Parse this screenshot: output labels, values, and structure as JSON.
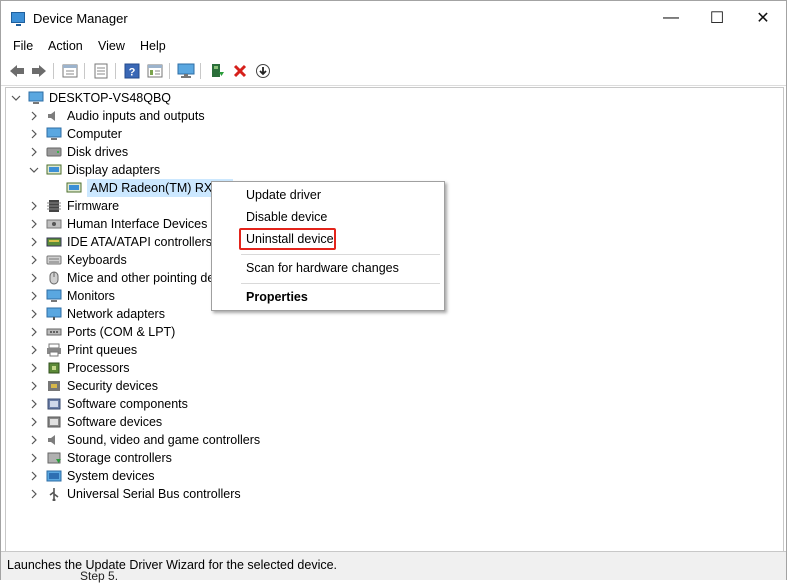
{
  "window": {
    "title": "Device Manager",
    "minimize": "—",
    "maximize": "☐",
    "close": "✕"
  },
  "menu": [
    "File",
    "Action",
    "View",
    "Help"
  ],
  "toolbar": [
    "back-arrow-icon",
    "forward-arrow-icon",
    "properties-icon",
    "list-icon",
    "help-icon",
    "details-icon",
    "monitor-icon",
    "update-driver-icon",
    "remove-icon",
    "download-icon"
  ],
  "tree": {
    "root": "DESKTOP-VS48QBQ",
    "categories": [
      {
        "label": "Audio inputs and outputs",
        "icon": "speaker-icon"
      },
      {
        "label": "Computer",
        "icon": "computer-icon"
      },
      {
        "label": "Disk drives",
        "icon": "disk-icon"
      },
      {
        "label": "Display adapters",
        "icon": "display-adapter-icon"
      },
      {
        "label": "AMD Radeon(TM) RX Ve",
        "icon": "display-adapter-icon"
      },
      {
        "label": "Firmware",
        "icon": "firmware-icon"
      },
      {
        "label": "Human Interface Devices",
        "icon": "hid-icon"
      },
      {
        "label": "IDE ATA/ATAPI controllers",
        "icon": "ide-icon"
      },
      {
        "label": "Keyboards",
        "icon": "keyboard-icon"
      },
      {
        "label": "Mice and other pointing de",
        "icon": "mouse-icon"
      },
      {
        "label": "Monitors",
        "icon": "monitor-icon"
      },
      {
        "label": "Network adapters",
        "icon": "network-icon"
      },
      {
        "label": "Ports (COM & LPT)",
        "icon": "port-icon"
      },
      {
        "label": "Print queues",
        "icon": "printer-icon"
      },
      {
        "label": "Processors",
        "icon": "processor-icon"
      },
      {
        "label": "Security devices",
        "icon": "security-icon"
      },
      {
        "label": "Software components",
        "icon": "software-component-icon"
      },
      {
        "label": "Software devices",
        "icon": "software-device-icon"
      },
      {
        "label": "Sound, video and game controllers",
        "icon": "sound-icon"
      },
      {
        "label": "Storage controllers",
        "icon": "storage-icon"
      },
      {
        "label": "System devices",
        "icon": "system-icon"
      },
      {
        "label": "Universal Serial Bus controllers",
        "icon": "usb-icon"
      }
    ]
  },
  "context_menu": {
    "update_driver": "Update driver",
    "disable_device": "Disable device",
    "uninstall_device": "Uninstall device",
    "scan": "Scan for hardware changes",
    "properties": "Properties"
  },
  "status": "Launches the Update Driver Wizard for the selected device.",
  "bleed_text": "Step 5.",
  "colors": {
    "selection": "#cce8ff",
    "highlight_box": "#e3241b"
  }
}
